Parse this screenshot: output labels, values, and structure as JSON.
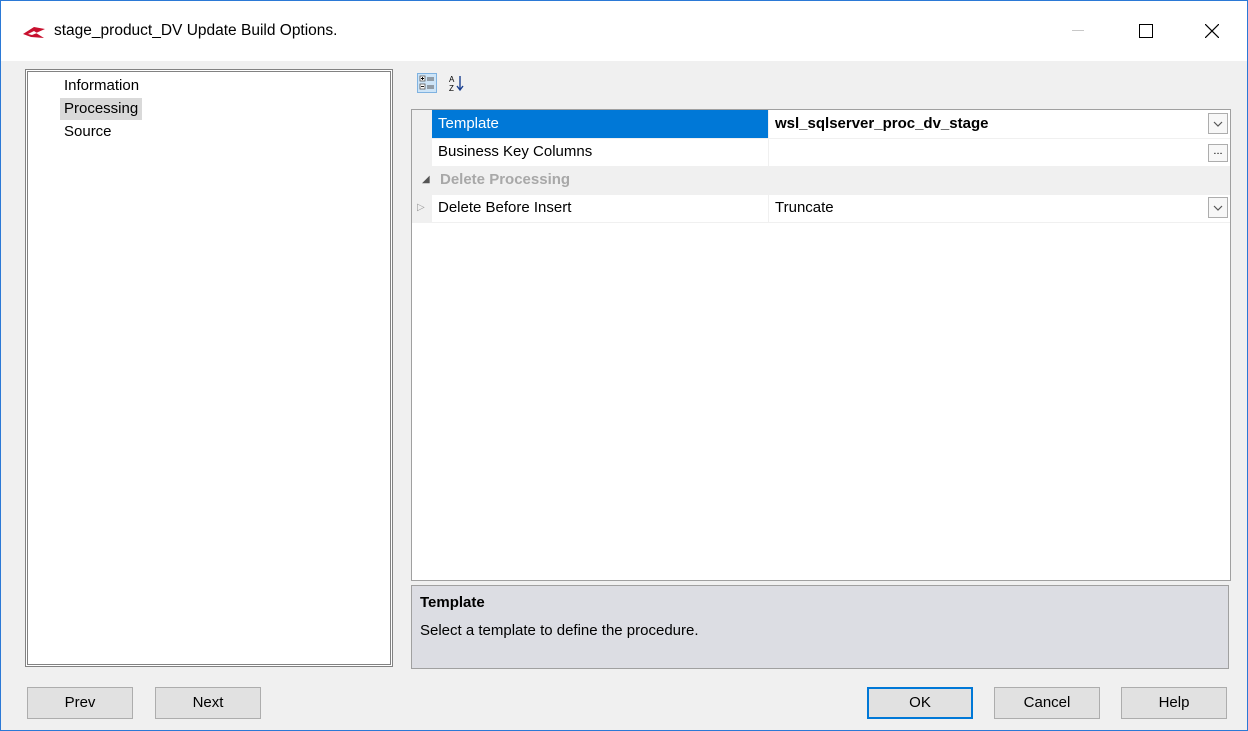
{
  "window": {
    "title": "stage_product_DV Update Build Options."
  },
  "tree": {
    "items": [
      {
        "label": "Information"
      },
      {
        "label": "Processing"
      },
      {
        "label": "Source"
      }
    ]
  },
  "toolbar": {
    "categorized_icon": "categorized-view-icon",
    "alphabetical_icon": "sort-alphabetical-icon"
  },
  "properties": {
    "template_name": "Template",
    "template_value": "wsl_sqlserver_proc_dv_stage",
    "business_key_name": "Business Key Columns",
    "business_key_value": "",
    "ellipsis": "...",
    "category_delete": "Delete Processing",
    "delete_before_insert_name": "Delete Before Insert",
    "delete_before_insert_value": "Truncate"
  },
  "help": {
    "title": "Template",
    "description": "Select a template to define the procedure."
  },
  "buttons": {
    "prev": "Prev",
    "next": "Next",
    "ok": "OK",
    "cancel": "Cancel",
    "help": "Help"
  },
  "colors": {
    "selection": "#0078d7",
    "window_border": "#2b79d6"
  }
}
